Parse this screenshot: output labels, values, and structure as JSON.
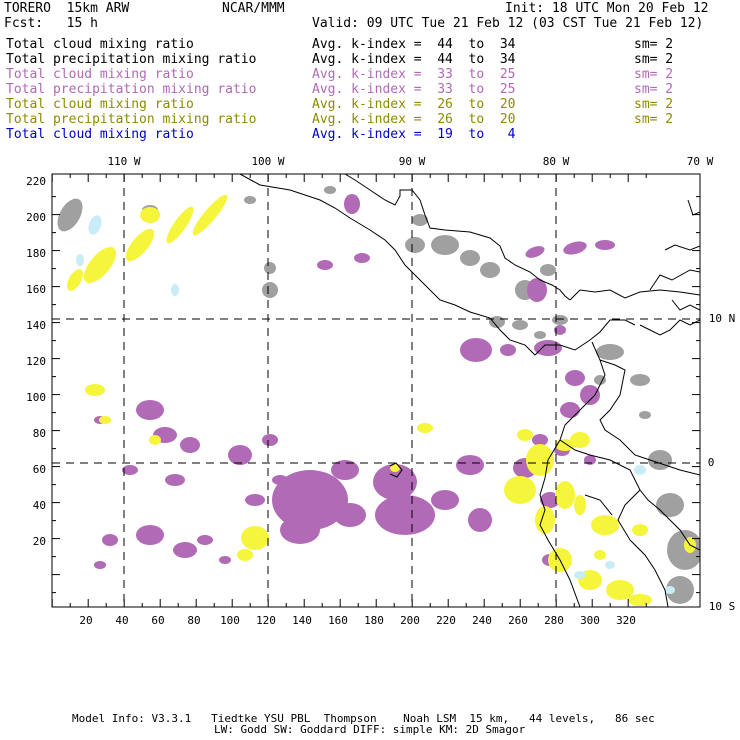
{
  "header": {
    "model": "TORERO  15km ARW",
    "org": "NCAR/MMM",
    "init": "Init: 18 UTC Mon 20 Feb 12",
    "fcst": "Fcst:   15 h",
    "valid": "Valid: 09 UTC Tue 21 Feb 12 (03 CST Tue 21 Feb 12)"
  },
  "legend_rows": [
    {
      "field": "Total cloud mixing ratio",
      "index": "Avg. k-index =  44  to  34",
      "sm": "sm= 2",
      "color": "#000000"
    },
    {
      "field": "Total precipitation mixing ratio",
      "index": "Avg. k-index =  44  to  34",
      "sm": "sm= 2",
      "color": "#000000"
    },
    {
      "field": "Total cloud mixing ratio",
      "index": "Avg. k-index =  33  to  25",
      "sm": "sm= 2",
      "color": "#b06ab6"
    },
    {
      "field": "Total precipitation mixing ratio",
      "index": "Avg. k-index =  33  to  25",
      "sm": "sm= 2",
      "color": "#b06ab6"
    },
    {
      "field": "Total cloud mixing ratio",
      "index": "Avg. k-index =  26  to  20",
      "sm": "sm= 2",
      "color": "#8c8c00"
    },
    {
      "field": "Total precipitation mixing ratio",
      "index": "Avg. k-index =  26  to  20",
      "sm": "sm= 2",
      "color": "#8c8c00"
    },
    {
      "field": "Total cloud mixing ratio",
      "index": "Avg. k-index =  19  to   4",
      "sm": "",
      "color": "#0000cc"
    }
  ],
  "lon_labels": [
    "110 W",
    "100 W",
    "90 W",
    "80 W",
    "70 W"
  ],
  "lat_labels": [
    "10 N",
    "0",
    "10 S"
  ],
  "x_ticks": [
    "20",
    "40",
    "60",
    "80",
    "100",
    "120",
    "140",
    "160",
    "180",
    "200",
    "220",
    "240",
    "260",
    "280",
    "300",
    "320"
  ],
  "y_ticks": [
    "220",
    "200",
    "180",
    "160",
    "140",
    "120",
    "100",
    "80",
    "60",
    "40",
    "20"
  ],
  "footer": {
    "line1": "Model Info: V3.3.1   Tiedtke YSU PBL  Thompson    Noah LSM  15 km,   44 levels,   86 sec",
    "line2": "LW: Godd SW: Goddard DIFF: simple KM: 2D Smagor"
  },
  "colors": {
    "gray": "#a0a0a0",
    "purple": "#b06ab6",
    "yellow": "#f5f53c",
    "lightblue": "#c8ecf8"
  }
}
